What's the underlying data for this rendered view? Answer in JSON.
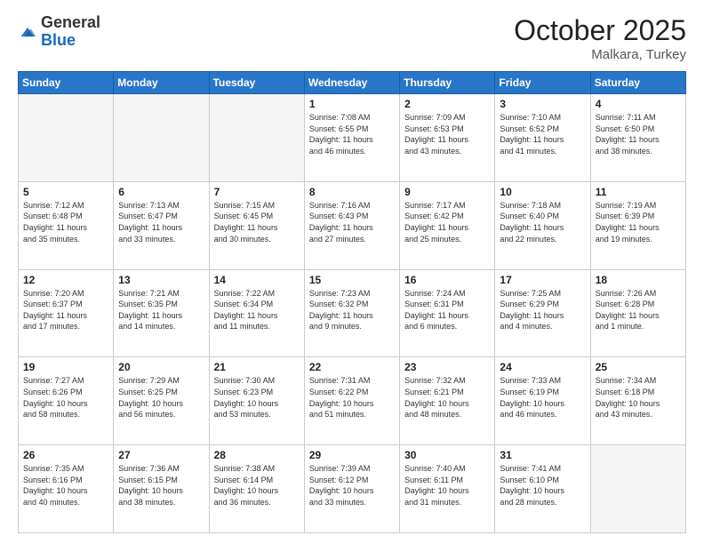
{
  "header": {
    "logo_general": "General",
    "logo_blue": "Blue",
    "month_title": "October 2025",
    "location": "Malkara, Turkey"
  },
  "days_of_week": [
    "Sunday",
    "Monday",
    "Tuesday",
    "Wednesday",
    "Thursday",
    "Friday",
    "Saturday"
  ],
  "weeks": [
    [
      {
        "day": "",
        "info": ""
      },
      {
        "day": "",
        "info": ""
      },
      {
        "day": "",
        "info": ""
      },
      {
        "day": "1",
        "info": "Sunrise: 7:08 AM\nSunset: 6:55 PM\nDaylight: 11 hours\nand 46 minutes."
      },
      {
        "day": "2",
        "info": "Sunrise: 7:09 AM\nSunset: 6:53 PM\nDaylight: 11 hours\nand 43 minutes."
      },
      {
        "day": "3",
        "info": "Sunrise: 7:10 AM\nSunset: 6:52 PM\nDaylight: 11 hours\nand 41 minutes."
      },
      {
        "day": "4",
        "info": "Sunrise: 7:11 AM\nSunset: 6:50 PM\nDaylight: 11 hours\nand 38 minutes."
      }
    ],
    [
      {
        "day": "5",
        "info": "Sunrise: 7:12 AM\nSunset: 6:48 PM\nDaylight: 11 hours\nand 35 minutes."
      },
      {
        "day": "6",
        "info": "Sunrise: 7:13 AM\nSunset: 6:47 PM\nDaylight: 11 hours\nand 33 minutes."
      },
      {
        "day": "7",
        "info": "Sunrise: 7:15 AM\nSunset: 6:45 PM\nDaylight: 11 hours\nand 30 minutes."
      },
      {
        "day": "8",
        "info": "Sunrise: 7:16 AM\nSunset: 6:43 PM\nDaylight: 11 hours\nand 27 minutes."
      },
      {
        "day": "9",
        "info": "Sunrise: 7:17 AM\nSunset: 6:42 PM\nDaylight: 11 hours\nand 25 minutes."
      },
      {
        "day": "10",
        "info": "Sunrise: 7:18 AM\nSunset: 6:40 PM\nDaylight: 11 hours\nand 22 minutes."
      },
      {
        "day": "11",
        "info": "Sunrise: 7:19 AM\nSunset: 6:39 PM\nDaylight: 11 hours\nand 19 minutes."
      }
    ],
    [
      {
        "day": "12",
        "info": "Sunrise: 7:20 AM\nSunset: 6:37 PM\nDaylight: 11 hours\nand 17 minutes."
      },
      {
        "day": "13",
        "info": "Sunrise: 7:21 AM\nSunset: 6:35 PM\nDaylight: 11 hours\nand 14 minutes."
      },
      {
        "day": "14",
        "info": "Sunrise: 7:22 AM\nSunset: 6:34 PM\nDaylight: 11 hours\nand 11 minutes."
      },
      {
        "day": "15",
        "info": "Sunrise: 7:23 AM\nSunset: 6:32 PM\nDaylight: 11 hours\nand 9 minutes."
      },
      {
        "day": "16",
        "info": "Sunrise: 7:24 AM\nSunset: 6:31 PM\nDaylight: 11 hours\nand 6 minutes."
      },
      {
        "day": "17",
        "info": "Sunrise: 7:25 AM\nSunset: 6:29 PM\nDaylight: 11 hours\nand 4 minutes."
      },
      {
        "day": "18",
        "info": "Sunrise: 7:26 AM\nSunset: 6:28 PM\nDaylight: 11 hours\nand 1 minute."
      }
    ],
    [
      {
        "day": "19",
        "info": "Sunrise: 7:27 AM\nSunset: 6:26 PM\nDaylight: 10 hours\nand 58 minutes."
      },
      {
        "day": "20",
        "info": "Sunrise: 7:29 AM\nSunset: 6:25 PM\nDaylight: 10 hours\nand 56 minutes."
      },
      {
        "day": "21",
        "info": "Sunrise: 7:30 AM\nSunset: 6:23 PM\nDaylight: 10 hours\nand 53 minutes."
      },
      {
        "day": "22",
        "info": "Sunrise: 7:31 AM\nSunset: 6:22 PM\nDaylight: 10 hours\nand 51 minutes."
      },
      {
        "day": "23",
        "info": "Sunrise: 7:32 AM\nSunset: 6:21 PM\nDaylight: 10 hours\nand 48 minutes."
      },
      {
        "day": "24",
        "info": "Sunrise: 7:33 AM\nSunset: 6:19 PM\nDaylight: 10 hours\nand 46 minutes."
      },
      {
        "day": "25",
        "info": "Sunrise: 7:34 AM\nSunset: 6:18 PM\nDaylight: 10 hours\nand 43 minutes."
      }
    ],
    [
      {
        "day": "26",
        "info": "Sunrise: 7:35 AM\nSunset: 6:16 PM\nDaylight: 10 hours\nand 40 minutes."
      },
      {
        "day": "27",
        "info": "Sunrise: 7:36 AM\nSunset: 6:15 PM\nDaylight: 10 hours\nand 38 minutes."
      },
      {
        "day": "28",
        "info": "Sunrise: 7:38 AM\nSunset: 6:14 PM\nDaylight: 10 hours\nand 36 minutes."
      },
      {
        "day": "29",
        "info": "Sunrise: 7:39 AM\nSunset: 6:12 PM\nDaylight: 10 hours\nand 33 minutes."
      },
      {
        "day": "30",
        "info": "Sunrise: 7:40 AM\nSunset: 6:11 PM\nDaylight: 10 hours\nand 31 minutes."
      },
      {
        "day": "31",
        "info": "Sunrise: 7:41 AM\nSunset: 6:10 PM\nDaylight: 10 hours\nand 28 minutes."
      },
      {
        "day": "",
        "info": ""
      }
    ]
  ]
}
